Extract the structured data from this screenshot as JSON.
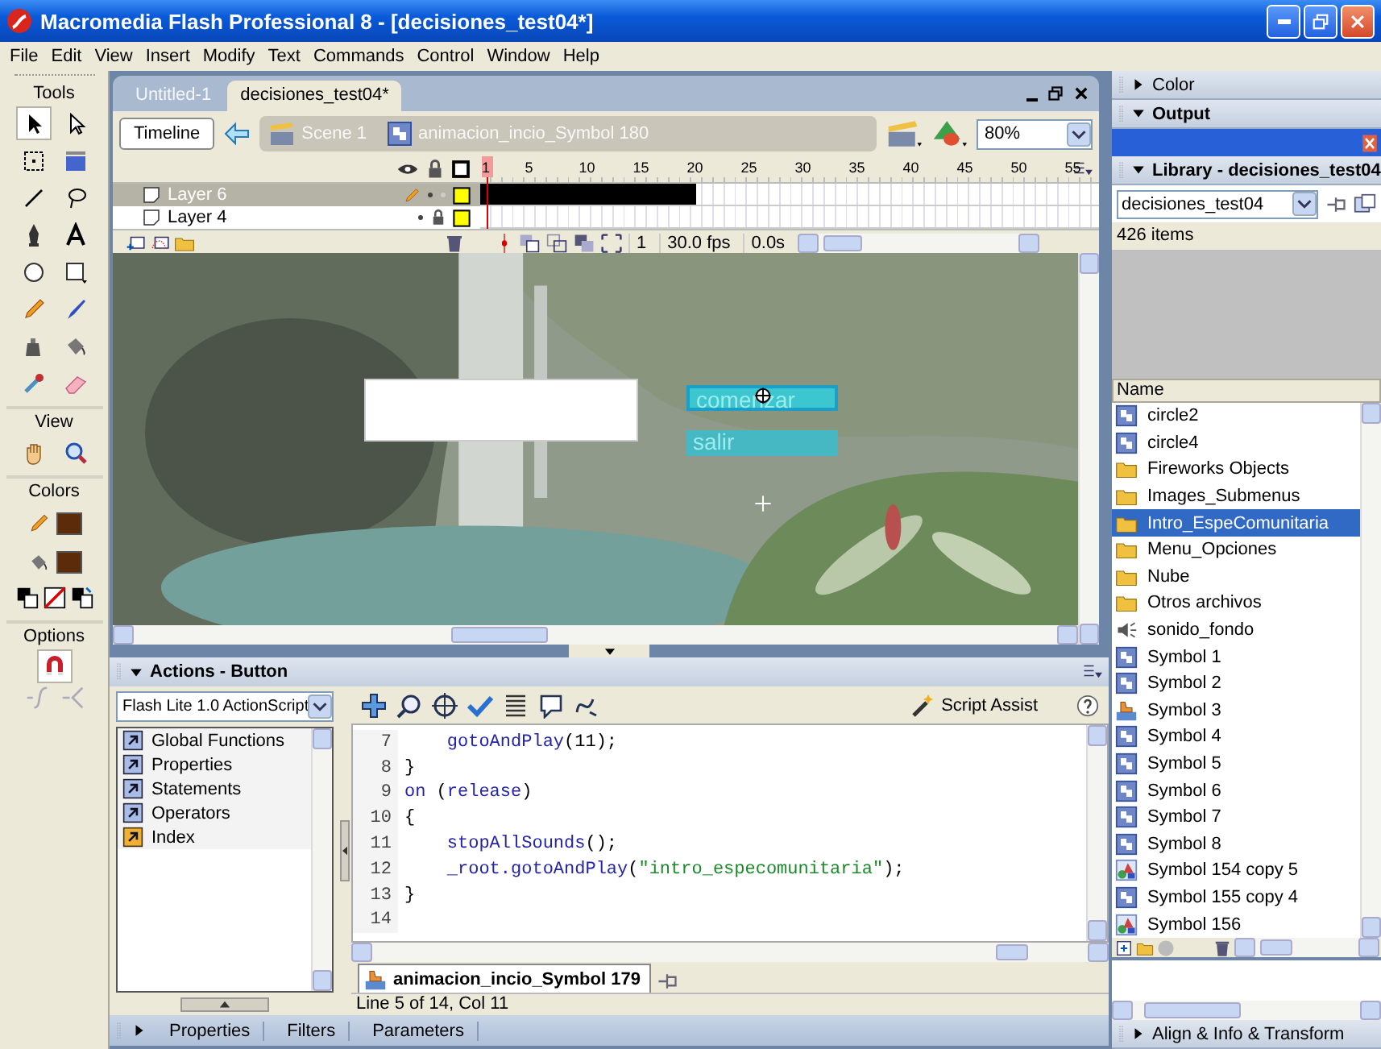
{
  "window": {
    "title": "Macromedia Flash Professional 8 - [decisiones_test04*]"
  },
  "menu": [
    "File",
    "Edit",
    "View",
    "Insert",
    "Modify",
    "Text",
    "Commands",
    "Control",
    "Window",
    "Help"
  ],
  "tools": {
    "title": "Tools",
    "items": [
      {
        "kind": "arrow",
        "selected": true
      },
      {
        "kind": "subselect",
        "selected": false
      },
      {
        "kind": "transform",
        "selected": false
      },
      {
        "kind": "gradient",
        "selected": false
      },
      {
        "kind": "line",
        "selected": false
      },
      {
        "kind": "lasso",
        "selected": false
      },
      {
        "kind": "pen",
        "selected": false
      },
      {
        "kind": "text",
        "selected": false
      },
      {
        "kind": "oval",
        "selected": false
      },
      {
        "kind": "rect",
        "selected": false
      },
      {
        "kind": "pencil",
        "selected": false
      },
      {
        "kind": "brush",
        "selected": false
      },
      {
        "kind": "inkbottle",
        "selected": false
      },
      {
        "kind": "bucket",
        "selected": false
      },
      {
        "kind": "dropper",
        "selected": false
      },
      {
        "kind": "eraser",
        "selected": false
      }
    ]
  },
  "view": {
    "title": "View",
    "items": [
      {
        "kind": "hand",
        "selected": false
      },
      {
        "kind": "zoom",
        "selected": false
      }
    ]
  },
  "colors": {
    "title": "Colors",
    "swatches": [
      {
        "kind": "stroke",
        "color": "#5c2c0a"
      },
      {
        "kind": "fill",
        "color": "#5c2c0a"
      }
    ]
  },
  "options": {
    "title": "Options",
    "snap": true
  },
  "document": {
    "tabs": [
      {
        "label": "Untitled-1",
        "selected": false
      },
      {
        "label": "decisiones_test04*",
        "selected": true
      }
    ],
    "timeline_button": "Timeline",
    "breadcrumb": [
      {
        "kind": "scene",
        "label": "Scene 1"
      },
      {
        "kind": "symbol",
        "label": "animacion_incio_Symbol 180"
      }
    ],
    "zoom": "80%",
    "frame_numbers": [
      "1",
      "5",
      "10",
      "15",
      "20",
      "25",
      "30",
      "35",
      "40",
      "45",
      "50",
      "55"
    ],
    "layers": [
      {
        "name": "Layer 6",
        "selected": true,
        "locked": false
      },
      {
        "name": "Layer 4",
        "selected": false,
        "locked": true
      }
    ],
    "current_frame": "1",
    "frame_rate": "30.0 fps",
    "elapsed": "0.0s",
    "stage": {
      "kind": "picture",
      "buttons": [
        {
          "label": "comenzar",
          "selected": true
        },
        {
          "label": "salir",
          "selected": false
        }
      ]
    }
  },
  "actions": {
    "title": "Actions - Button",
    "expanded": true,
    "version": "Flash Lite 1.0 ActionScript",
    "categories": [
      {
        "label": "Global Functions",
        "kind": "book",
        "selected": false
      },
      {
        "label": "Properties",
        "kind": "book",
        "selected": false
      },
      {
        "label": "Statements",
        "kind": "book",
        "selected": false
      },
      {
        "label": "Operators",
        "kind": "book",
        "selected": false
      },
      {
        "label": "Index",
        "kind": "index",
        "selected": false
      }
    ],
    "script_assist": "Script Assist",
    "code": [
      {
        "number": "7",
        "tokens": [
          {
            "kind": "function",
            "text": "    gotoAndPlay"
          },
          {
            "kind": "plain",
            "text": "(11);"
          }
        ]
      },
      {
        "number": "8",
        "tokens": [
          {
            "kind": "plain",
            "text": "}"
          }
        ]
      },
      {
        "number": "9",
        "tokens": [
          {
            "kind": "function",
            "text": "on"
          },
          {
            "kind": "plain",
            "text": " ("
          },
          {
            "kind": "function",
            "text": "release"
          },
          {
            "kind": "plain",
            "text": ")"
          }
        ]
      },
      {
        "number": "10",
        "tokens": [
          {
            "kind": "plain",
            "text": "{"
          }
        ]
      },
      {
        "number": "11",
        "tokens": [
          {
            "kind": "function",
            "text": "    stopAllSounds"
          },
          {
            "kind": "plain",
            "text": "();"
          }
        ]
      },
      {
        "number": "12",
        "tokens": [
          {
            "kind": "function",
            "text": "    _root.gotoAndPlay"
          },
          {
            "kind": "plain",
            "text": "("
          },
          {
            "kind": "string",
            "text": "\"intro_especomunitaria\""
          },
          {
            "kind": "plain",
            "text": ");"
          }
        ]
      },
      {
        "number": "13",
        "tokens": [
          {
            "kind": "plain",
            "text": "}"
          }
        ]
      },
      {
        "number": "14"
      }
    ],
    "script_tab": "animacion_incio_Symbol 179",
    "status": "Line 5 of 14, Col 11"
  },
  "properties_bar": {
    "expanded": false,
    "tabs": [
      "Properties",
      "Filters",
      "Parameters"
    ]
  },
  "side_panels": [
    {
      "title": "Color",
      "expanded": false
    },
    {
      "title": "Output",
      "expanded": true
    }
  ],
  "library": {
    "title": "Library - decisiones_test04",
    "expanded": true,
    "document": "decisiones_test04",
    "count": "426 items",
    "column": "Name",
    "items": [
      {
        "label": "circle2",
        "kind": "symbol",
        "selected": false
      },
      {
        "label": "circle4",
        "kind": "symbol",
        "selected": false
      },
      {
        "label": "Fireworks Objects",
        "kind": "folder",
        "selected": false
      },
      {
        "label": "Images_Submenus",
        "kind": "folder",
        "selected": false
      },
      {
        "label": "Intro_EspeComunitaria",
        "kind": "folder",
        "selected": true
      },
      {
        "label": "Menu_Opciones",
        "kind": "folder",
        "selected": false
      },
      {
        "label": "Nube",
        "kind": "folder",
        "selected": false
      },
      {
        "label": "Otros archivos",
        "kind": "folder",
        "selected": false
      },
      {
        "label": "sonido_fondo",
        "kind": "sound",
        "selected": false
      },
      {
        "label": "Symbol 1",
        "kind": "symbol",
        "selected": false
      },
      {
        "label": "Symbol 2",
        "kind": "symbol",
        "selected": false
      },
      {
        "label": "Symbol 3",
        "kind": "button",
        "selected": false
      },
      {
        "label": "Symbol 4",
        "kind": "symbol",
        "selected": false
      },
      {
        "label": "Symbol 5",
        "kind": "symbol",
        "selected": false
      },
      {
        "label": "Symbol 6",
        "kind": "symbol",
        "selected": false
      },
      {
        "label": "Symbol 7",
        "kind": "symbol",
        "selected": false
      },
      {
        "label": "Symbol 8",
        "kind": "symbol",
        "selected": false
      },
      {
        "label": "Symbol 154 copy 5",
        "kind": "graphic",
        "selected": false
      },
      {
        "label": "Symbol 155 copy 4",
        "kind": "symbol",
        "selected": false
      },
      {
        "label": "Symbol 156",
        "kind": "graphic",
        "selected": false
      }
    ]
  },
  "align_panel": {
    "title": "Align & Info & Transform",
    "expanded": false
  }
}
